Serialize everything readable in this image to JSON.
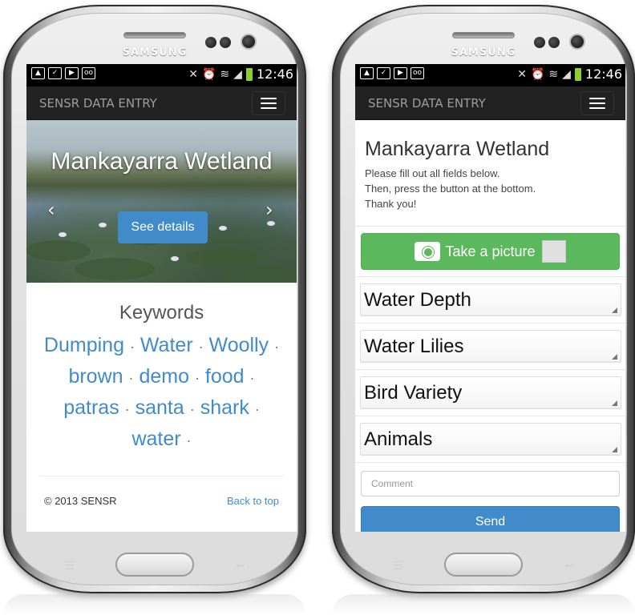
{
  "device": {
    "brand": "SAMSUNG"
  },
  "status_bar": {
    "time": "12:46"
  },
  "navbar": {
    "title": "SENSR DATA ENTRY"
  },
  "left_screen": {
    "hero": {
      "title": "Mankayarra Wetland",
      "button_label": "See details",
      "prev_arrow": "‹",
      "next_arrow": "›"
    },
    "keywords_heading": "Keywords",
    "keywords": [
      "Dumping",
      "Water",
      "Woolly",
      "brown",
      "demo",
      "food",
      "patras",
      "santa",
      "shark",
      "water"
    ],
    "keyword_separator": "·",
    "footer": {
      "copyright": "© 2013 SENSR",
      "back_to_top": "Back to top"
    }
  },
  "right_screen": {
    "title": "Mankayarra Wetland",
    "instructions": [
      "Please fill out all fields below.",
      "Then, press the button at the bottom.",
      "Thank you!"
    ],
    "picture_button": "Take a picture",
    "fields": [
      "Water Depth",
      "Water Lilies",
      "Bird Variety",
      "Animals"
    ],
    "comment_placeholder": "Comment",
    "send_button": "Send"
  },
  "colors": {
    "primary": "#428bca",
    "success": "#5cb85c",
    "navbar": "#222222",
    "battery": "#8bd12a"
  }
}
